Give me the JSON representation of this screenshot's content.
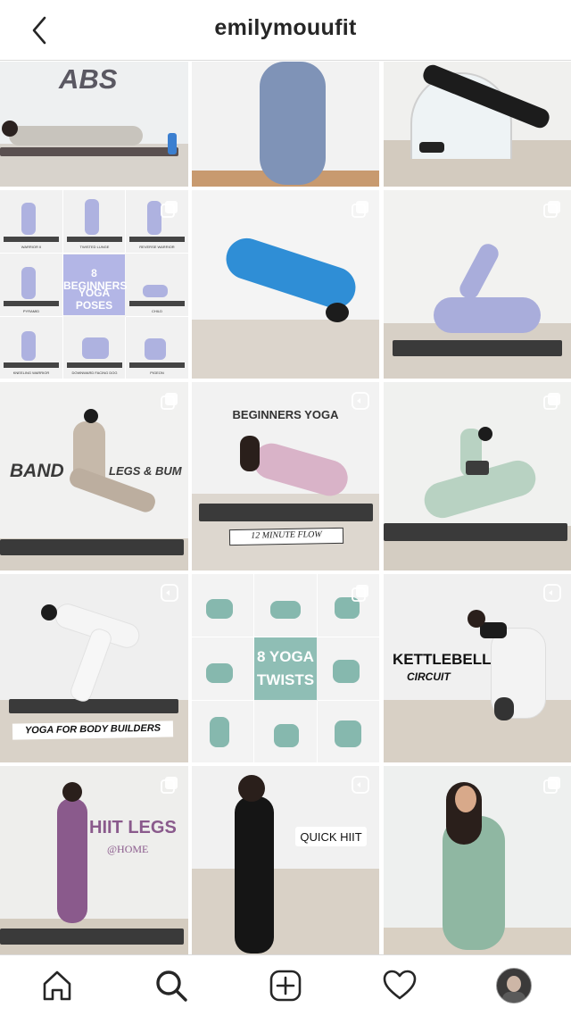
{
  "header": {
    "title": "emilymouufit"
  },
  "posts": {
    "p1": {
      "title": "ABS"
    },
    "p4": {
      "title_line1": "8 BEGINNERS",
      "title_line2": "YOGA POSES",
      "captions": [
        "WARRIOR II",
        "TWISTED LUNGE",
        "REVERSE WARRIOR",
        "PYRAMID",
        "CHILD",
        "KNEELING WARRIOR",
        "DOWNWARD FACING DOG",
        "PIGEON"
      ]
    },
    "p7": {
      "left": "BAND",
      "right": "LEGS & BUM"
    },
    "p8": {
      "title": "BEGINNERS YOGA",
      "subtitle": "12 MINUTE FLOW"
    },
    "p10": {
      "title": "YOGA FOR BODY BUILDERS"
    },
    "p11": {
      "line1": "8 YOGA",
      "line2": "TWISTS"
    },
    "p12": {
      "line1": "KETTLEBELL",
      "line2": "CIRCUIT"
    },
    "p13": {
      "title": "HIIT LEGS",
      "subtitle": "@HOME"
    },
    "p14": {
      "title": "QUICK HIIT"
    }
  },
  "colors": {
    "accent_lavender": "#b3b6e6",
    "accent_teal": "#8fbeb5",
    "hiit_purple": "#8a5a8c"
  }
}
